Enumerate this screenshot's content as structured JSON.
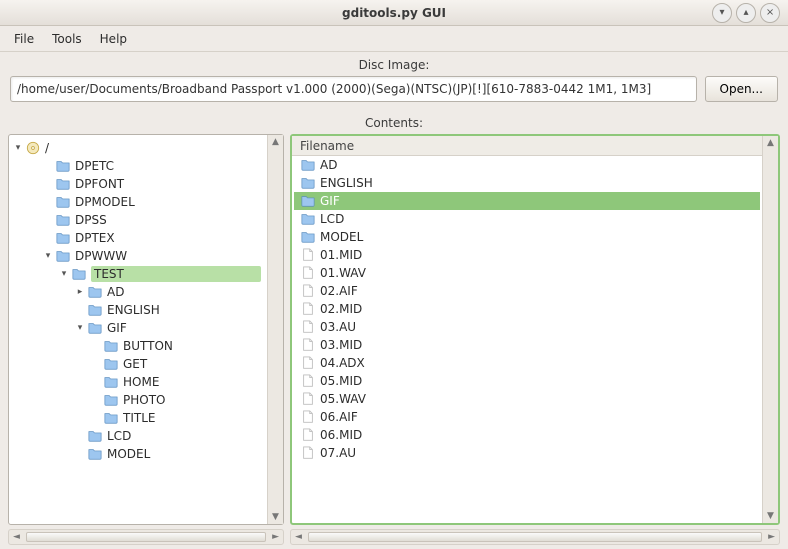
{
  "window": {
    "title": "gditools.py GUI"
  },
  "menu": {
    "file": "File",
    "tools": "Tools",
    "help": "Help"
  },
  "disc": {
    "label": "Disc Image:",
    "path": "/home/user/Documents/Broadband Passport v1.000 (2000)(Sega)(NTSC)(JP)[!][610-7883-0442 1M1, 1M3]",
    "open": "Open..."
  },
  "contents_label": "Contents:",
  "tree": {
    "root": "/",
    "items": [
      {
        "d": 1,
        "exp": "",
        "icon": "folder",
        "label": "DPETC"
      },
      {
        "d": 1,
        "exp": "",
        "icon": "folder",
        "label": "DPFONT"
      },
      {
        "d": 1,
        "exp": "",
        "icon": "folder",
        "label": "DPMODEL"
      },
      {
        "d": 1,
        "exp": "",
        "icon": "folder",
        "label": "DPSS"
      },
      {
        "d": 1,
        "exp": "",
        "icon": "folder",
        "label": "DPTEX"
      },
      {
        "d": 1,
        "exp": "v",
        "icon": "folder",
        "label": "DPWWW"
      },
      {
        "d": 2,
        "exp": "v",
        "icon": "folder",
        "label": "TEST",
        "sel": true
      },
      {
        "d": 3,
        "exp": ">",
        "icon": "folder",
        "label": "AD"
      },
      {
        "d": 3,
        "exp": "",
        "icon": "folder",
        "label": "ENGLISH"
      },
      {
        "d": 3,
        "exp": "v",
        "icon": "folder",
        "label": "GIF"
      },
      {
        "d": 4,
        "exp": "",
        "icon": "folder",
        "label": "BUTTON"
      },
      {
        "d": 4,
        "exp": "",
        "icon": "folder",
        "label": "GET"
      },
      {
        "d": 4,
        "exp": "",
        "icon": "folder",
        "label": "HOME"
      },
      {
        "d": 4,
        "exp": "",
        "icon": "folder",
        "label": "PHOTO"
      },
      {
        "d": 4,
        "exp": "",
        "icon": "folder",
        "label": "TITLE"
      },
      {
        "d": 3,
        "exp": "",
        "icon": "folder",
        "label": "LCD"
      },
      {
        "d": 3,
        "exp": "",
        "icon": "folder",
        "label": "MODEL"
      }
    ]
  },
  "list": {
    "header": "Filename",
    "items": [
      {
        "icon": "folder",
        "label": "AD"
      },
      {
        "icon": "folder",
        "label": "ENGLISH"
      },
      {
        "icon": "folder",
        "label": "GIF",
        "sel": true
      },
      {
        "icon": "folder",
        "label": "LCD"
      },
      {
        "icon": "folder",
        "label": "MODEL"
      },
      {
        "icon": "file",
        "label": "01.MID"
      },
      {
        "icon": "file",
        "label": "01.WAV"
      },
      {
        "icon": "file",
        "label": "02.AIF"
      },
      {
        "icon": "file",
        "label": "02.MID"
      },
      {
        "icon": "file",
        "label": "03.AU"
      },
      {
        "icon": "file",
        "label": "03.MID"
      },
      {
        "icon": "file",
        "label": "04.ADX"
      },
      {
        "icon": "file",
        "label": "05.MID"
      },
      {
        "icon": "file",
        "label": "05.WAV"
      },
      {
        "icon": "file",
        "label": "06.AIF"
      },
      {
        "icon": "file",
        "label": "06.MID"
      },
      {
        "icon": "file",
        "label": "07.AU"
      }
    ]
  }
}
